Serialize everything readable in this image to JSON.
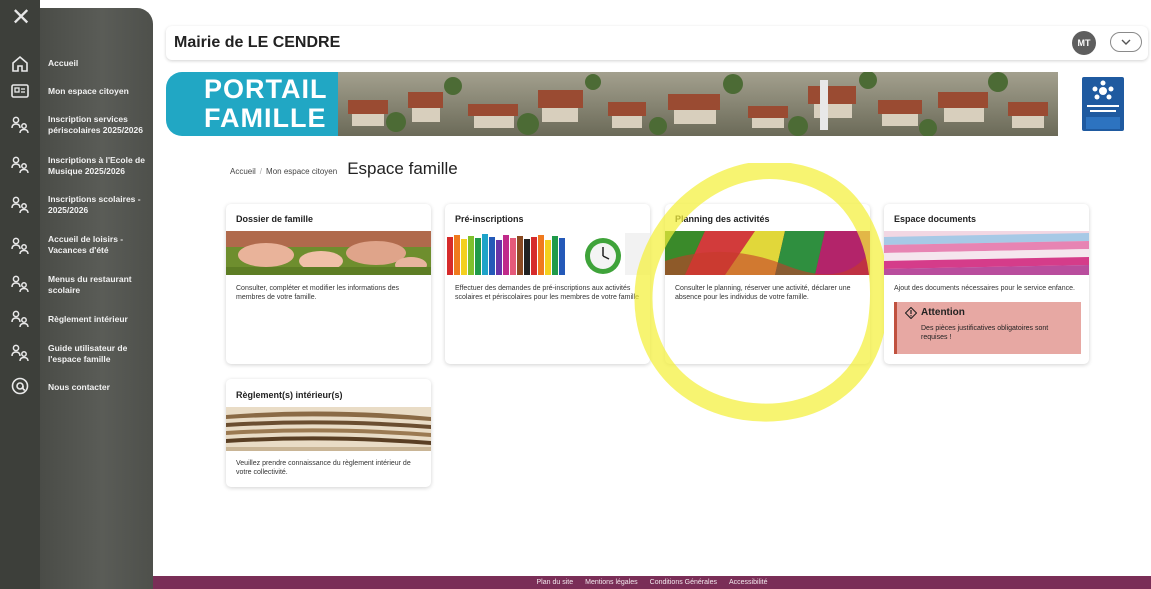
{
  "sidebar": {
    "close_icon": "close-icon",
    "items": [
      {
        "label": "Accueil",
        "icon": "home-icon"
      },
      {
        "label": "Mon espace citoyen",
        "icon": "id-card-icon"
      },
      {
        "label": "Inscription services\npériscolaires 2025/2026",
        "icon": "family-icon"
      },
      {
        "label": "Inscriptions à l'Ecole de\nMusique 2025/2026",
        "icon": "family-icon"
      },
      {
        "label": "Inscriptions scolaires -\n2025/2026",
        "icon": "family-icon"
      },
      {
        "label": "Accueil de loisirs -\nVacances d'été",
        "icon": "family-icon"
      },
      {
        "label": "Menus du restaurant\nscolaire",
        "icon": "family-icon"
      },
      {
        "label": "Règlement intérieur",
        "icon": "family-icon"
      },
      {
        "label": "Guide utilisateur de\nl'espace famille",
        "icon": "family-icon"
      },
      {
        "label": "Nous contacter",
        "icon": "at-icon"
      }
    ]
  },
  "header": {
    "title": "Mairie de LE CENDRE",
    "avatar_initials": "MT"
  },
  "banner": {
    "text": "PORTAIL\nFAMILLE"
  },
  "breadcrumb": {
    "items": [
      "Accueil",
      "Mon espace citoyen"
    ],
    "current": "Espace famille"
  },
  "cards": [
    {
      "title": "Dossier de famille",
      "description": "Consulter, compléter et modifier les informations des membres de votre famille."
    },
    {
      "title": "Pré-inscriptions",
      "description": "Effectuer des demandes de pré-inscriptions aux activités scolaires et périscolaires pour les membres de votre famille"
    },
    {
      "title": "Planning des activités",
      "description": "Consulter le planning, réserver une activité, déclarer une absence pour les individus de votre famille."
    },
    {
      "title": "Espace documents",
      "description": "Ajout des documents nécessaires pour le service enfance.",
      "alert": {
        "title": "Attention",
        "text": "Des pièces justificatives obligatoires sont requises !"
      }
    },
    {
      "title": "Règlement(s) intérieur(s)",
      "description": "Veuillez prendre connaissance du règlement intérieur de votre collectivité."
    }
  ],
  "footer": {
    "links": [
      "Plan du site",
      "Mentions légales",
      "Conditions Générales",
      "Accessibilité"
    ]
  },
  "colors": {
    "sidebar": "#4a4c47",
    "banner_blue": "#21a7c4",
    "footer": "#7a2e57",
    "alert_bg": "#e7a8a3",
    "highlight": "#f5f542"
  }
}
